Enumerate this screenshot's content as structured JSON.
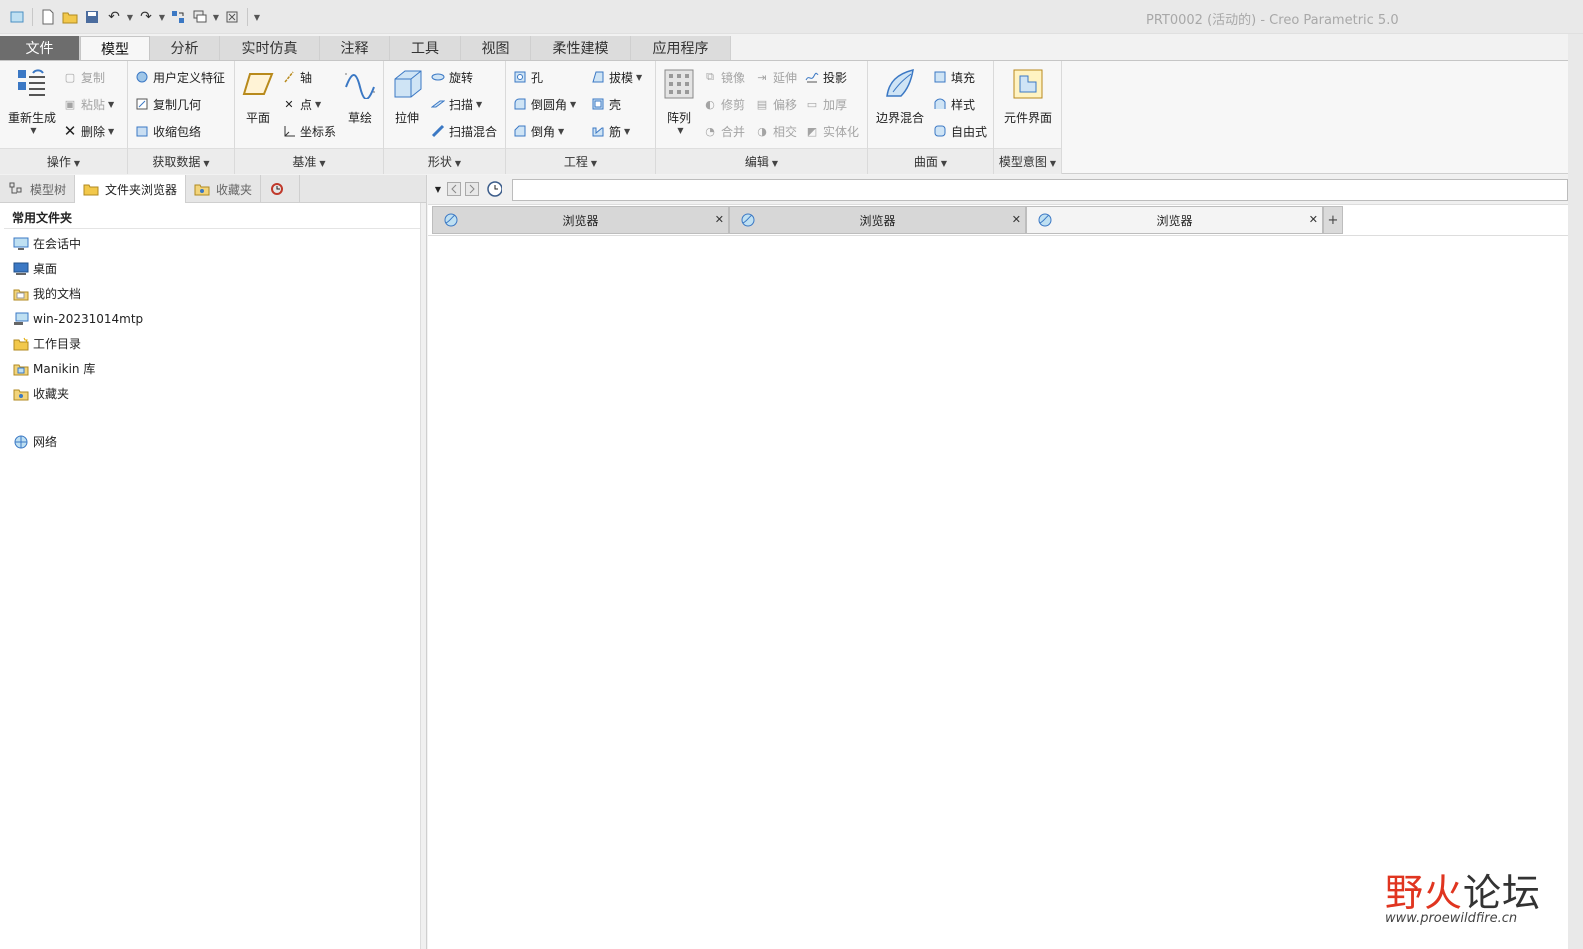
{
  "window": {
    "title": "PRT0002 (活动的) - Creo Parametric 5.0"
  },
  "tabs": [
    "文件",
    "模型",
    "分析",
    "实时仿真",
    "注释",
    "工具",
    "视图",
    "柔性建模",
    "应用程序"
  ],
  "active_tab": "模型",
  "ribbon": {
    "ops": {
      "label": "操作",
      "regen": "重新生成",
      "copy": "复制",
      "paste": "粘贴",
      "delete": "删除"
    },
    "getdata": {
      "label": "获取数据",
      "udf": "用户定义特征",
      "copygeom": "复制几何",
      "shrink": "收缩包络"
    },
    "datum": {
      "label": "基准",
      "plane": "平面",
      "axis": "轴",
      "point": "点",
      "csys": "坐标系",
      "sketch": "草绘"
    },
    "shapes": {
      "label": "形状",
      "extrude": "拉伸",
      "revolve": "旋转",
      "sweep": "扫描",
      "swept_blend": "扫描混合"
    },
    "engineering": {
      "label": "工程",
      "hole": "孔",
      "round": "倒圆角",
      "chamfer": "倒角",
      "draft": "拔模",
      "shell": "壳",
      "rib": "筋"
    },
    "editing": {
      "label": "编辑",
      "pattern": "阵列",
      "mirror": "镜像",
      "extend": "延伸",
      "project": "投影",
      "trim": "修剪",
      "offset": "偏移",
      "thicken": "加厚",
      "merge": "合并",
      "intersect": "相交",
      "solidify": "实体化"
    },
    "surfaces": {
      "label": "曲面",
      "boundary": "边界混合",
      "fill": "填充",
      "style": "样式",
      "freestyle": "自由式"
    },
    "intent": {
      "label": "模型意图",
      "component": "元件界面"
    }
  },
  "left_panel": {
    "tabs": [
      "模型树",
      "文件夹浏览器",
      "收藏夹"
    ],
    "active_tab": "文件夹浏览器",
    "header": "常用文件夹",
    "items": [
      "在会话中",
      "桌面",
      "我的文档",
      "win-20231014mtp",
      "工作目录",
      "Manikin 库",
      "收藏夹"
    ],
    "network": "网络"
  },
  "browser": {
    "tabs": [
      "浏览器",
      "浏览器",
      "浏览器"
    ],
    "address": ""
  },
  "watermark": {
    "text_a": "野火",
    "text_b": "论坛",
    "url": "www.proewildfire.cn"
  }
}
